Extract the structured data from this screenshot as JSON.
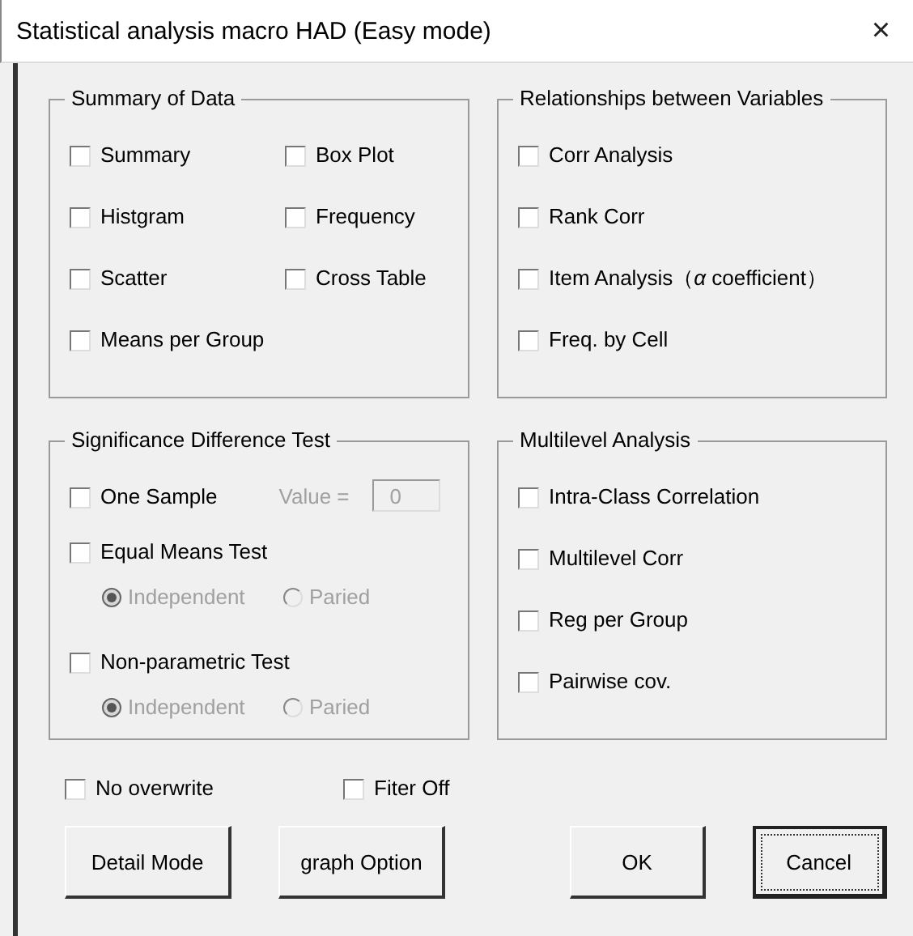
{
  "window": {
    "title": "Statistical analysis macro HAD (Easy mode)",
    "close": "×"
  },
  "groups": [
    {
      "title": "Summary of Data",
      "items": [
        {
          "kind": "checkbox",
          "label": "Summary",
          "checked": false
        },
        {
          "kind": "checkbox",
          "label": "Box Plot",
          "checked": false
        },
        {
          "kind": "checkbox",
          "label": "Histgram",
          "checked": false
        },
        {
          "kind": "checkbox",
          "label": "Frequency",
          "checked": false
        },
        {
          "kind": "checkbox",
          "label": "Scatter",
          "checked": false
        },
        {
          "kind": "checkbox",
          "label": "Cross Table",
          "checked": false
        },
        {
          "kind": "checkbox",
          "label": "Means per Group",
          "checked": false
        }
      ]
    },
    {
      "title": "Relationships between Variables",
      "items": [
        {
          "kind": "checkbox",
          "label": "Corr Analysis",
          "checked": false
        },
        {
          "kind": "checkbox",
          "label": "Rank Corr",
          "checked": false
        },
        {
          "kind": "checkbox",
          "label": "Item Analysis（*α* coefficient）",
          "checked": false
        },
        {
          "kind": "checkbox",
          "label": "Freq. by Cell",
          "checked": false
        }
      ]
    },
    {
      "title": "Significance Difference Test",
      "items": [
        {
          "kind": "checkbox",
          "label": "One Sample",
          "checked": false,
          "field": {
            "label": "Value =",
            "value": "0",
            "disabled": true
          }
        },
        {
          "kind": "checkbox",
          "label": "Equal Means Test",
          "checked": false
        },
        {
          "kind": "radio_row",
          "disabled": true,
          "options": [
            {
              "label": "Independent",
              "selected": true
            },
            {
              "label": "Paried",
              "selected": false
            }
          ]
        },
        {
          "kind": "checkbox",
          "label": "Non-parametric Test",
          "checked": false
        },
        {
          "kind": "radio_row",
          "disabled": true,
          "options": [
            {
              "label": "Independent",
              "selected": true
            },
            {
              "label": "Paried",
              "selected": false
            }
          ]
        }
      ]
    },
    {
      "title": "Multilevel Analysis",
      "items": [
        {
          "kind": "checkbox",
          "label": "Intra-Class Correlation",
          "checked": false
        },
        {
          "kind": "checkbox",
          "label": "Multilevel Corr",
          "checked": false
        },
        {
          "kind": "checkbox",
          "label": "Reg per Group",
          "checked": false
        },
        {
          "kind": "checkbox",
          "label": "Pairwise cov.",
          "checked": false
        }
      ]
    }
  ],
  "options": [
    {
      "label": "No overwrite",
      "checked": false
    },
    {
      "label": "Fiter Off",
      "checked": false
    }
  ],
  "buttons": [
    {
      "label": "Detail Mode",
      "focused": false
    },
    {
      "label": "graph Option",
      "focused": false
    },
    {
      "label": "OK",
      "focused": false
    },
    {
      "label": "Cancel",
      "focused": true
    }
  ]
}
